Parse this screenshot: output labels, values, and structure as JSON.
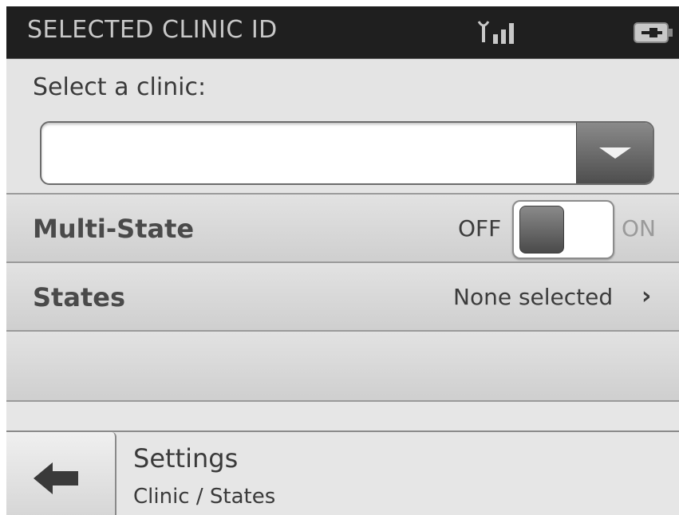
{
  "header": {
    "title": "SELECTED CLINIC ID",
    "signal_icon": "signal-strength-icon",
    "battery_icon": "battery-charging-icon"
  },
  "clinic": {
    "label": "Select a clinic:",
    "selected_value": "",
    "dropdown_icon": "chevron-down-icon"
  },
  "multi_state": {
    "label": "Multi-State",
    "off_label": "OFF",
    "on_label": "ON",
    "state": "off"
  },
  "states": {
    "label": "States",
    "value": "None selected",
    "chevron": "›"
  },
  "footer": {
    "back_icon": "arrow-left-icon",
    "title": "Settings",
    "breadcrumb": "Clinic / States"
  },
  "colors": {
    "header_bg": "#1f1f1f",
    "screen_bg": "#e6e6e6",
    "accent_gray": "#4e4e4e"
  }
}
